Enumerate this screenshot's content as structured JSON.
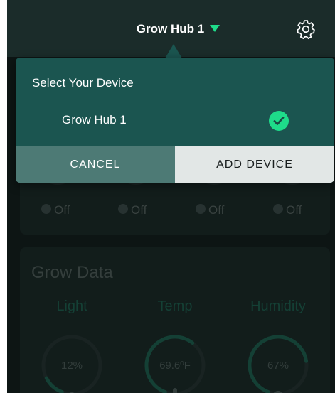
{
  "header": {
    "title": "Grow Hub 1",
    "caret_icon": "triangle-down-icon",
    "settings_icon": "gear-icon"
  },
  "dialog": {
    "title": "Select Your Device",
    "devices": [
      {
        "name": "Grow Hub 1",
        "selected": true,
        "icon": "check-circle-icon"
      }
    ],
    "cancel_label": "CANCEL",
    "add_label": "ADD DEVICE"
  },
  "outlets": [
    {
      "status": "Off"
    },
    {
      "status": "Off"
    },
    {
      "status": "Off"
    },
    {
      "status": "Off"
    }
  ],
  "grow_data": {
    "title": "Grow Data",
    "metrics": [
      {
        "label": "Light",
        "value": "12%",
        "level": 0.12,
        "icon": "sun-icon"
      },
      {
        "label": "Temp",
        "value": "69.6ºF",
        "level": 0.55,
        "icon": "thermometer-icon"
      },
      {
        "label": "Humidity",
        "value": "67%",
        "level": 0.67,
        "icon": "droplet-icon"
      }
    ]
  },
  "colors": {
    "accent": "#1edc8a",
    "dialog_bg": "#1b5550",
    "header_bg": "#1b2c2a",
    "app_bg": "#121c1b"
  }
}
